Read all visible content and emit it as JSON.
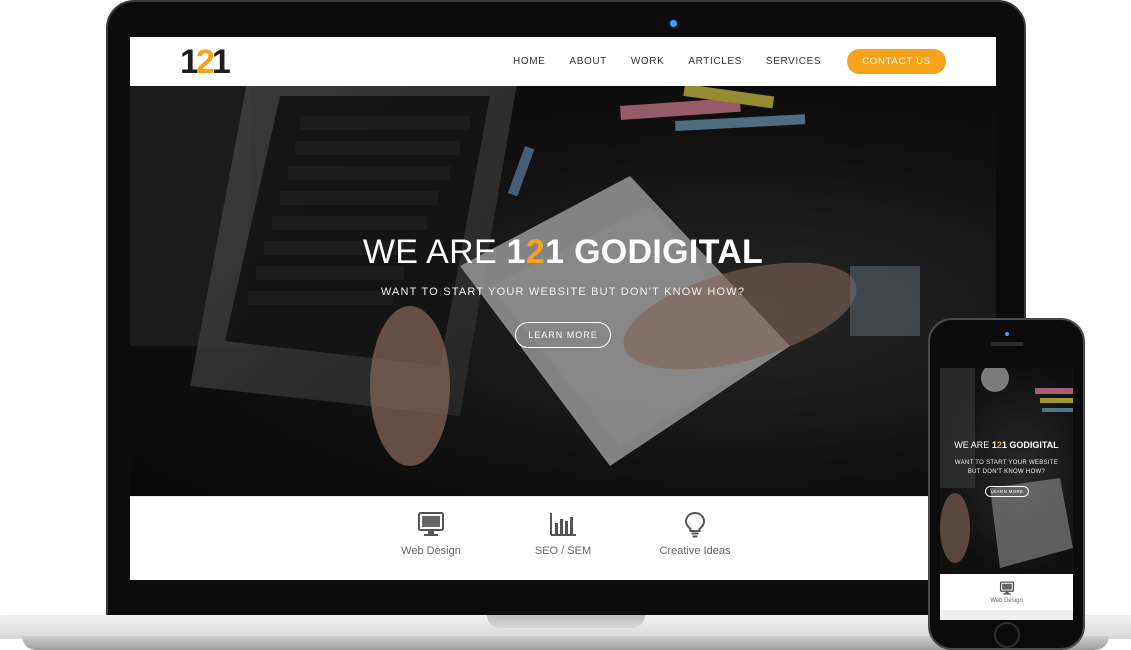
{
  "brand": {
    "logo_text": "1",
    "logo_accent": "2",
    "logo_text_end": "1",
    "accent_color": "#f7a21b"
  },
  "nav": {
    "items": [
      {
        "label": "HOME"
      },
      {
        "label": "ABOUT"
      },
      {
        "label": "WORK"
      },
      {
        "label": "ARTICLES"
      },
      {
        "label": "SERVICES"
      }
    ],
    "cta_label": "CONTACT US"
  },
  "hero": {
    "title_prefix": "WE ARE ",
    "title_part1": "1",
    "title_accent": "2",
    "title_part2": "1 GODIGITAL",
    "subtitle": "WANT TO START YOUR WEBSITE BUT DON'T KNOW HOW?",
    "button_label": "LEARN MORE"
  },
  "services": [
    {
      "label": "Web Design",
      "icon": "monitor-icon"
    },
    {
      "label": "SEO / SEM",
      "icon": "bar-chart-icon"
    },
    {
      "label": "Creative Ideas",
      "icon": "lightbulb-icon"
    }
  ],
  "phone": {
    "title_prefix": "WE ARE ",
    "title_part1": "1",
    "title_accent": "2",
    "title_part2": "1 GODIGITAL",
    "subtitle_line1": "WANT TO START YOUR WEBSITE",
    "subtitle_line2": "BUT DON'T KNOW HOW?",
    "button_label": "LEARN MORE",
    "service_label": "Web Design"
  }
}
